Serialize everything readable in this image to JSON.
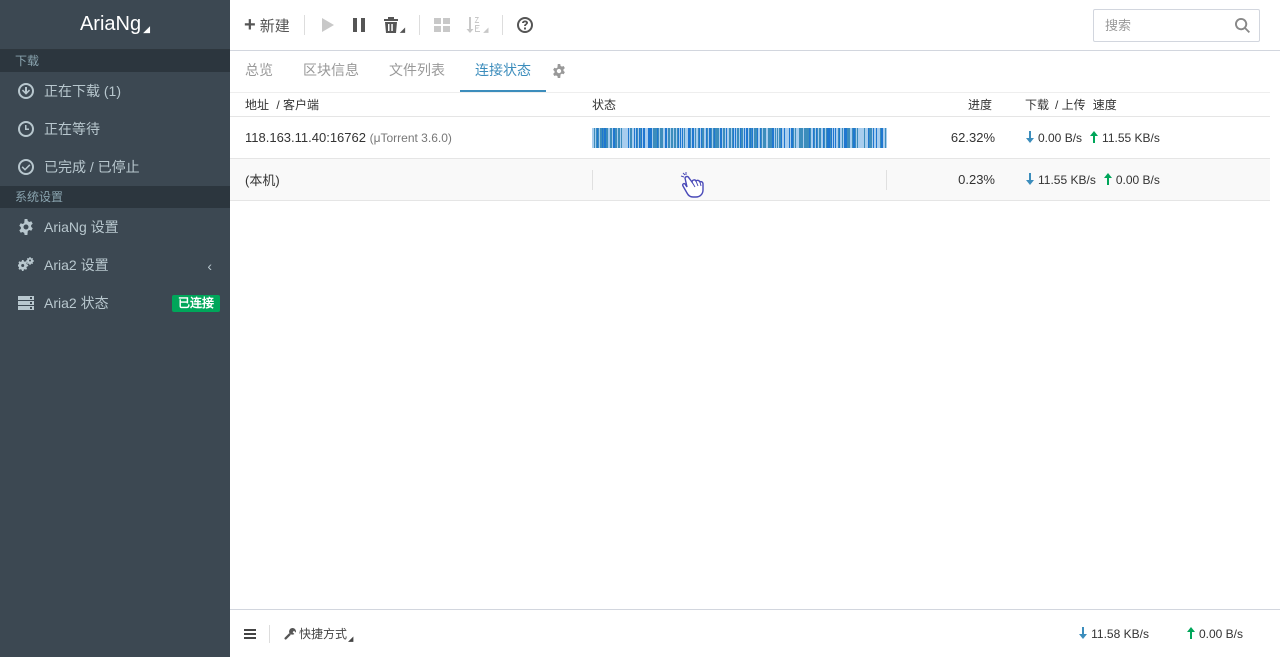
{
  "app": {
    "brand": "AriaNg"
  },
  "sidebar": {
    "download_header": "下载",
    "download_items": [
      {
        "label": "正在下载 (1)",
        "icon": "download-circle-icon"
      },
      {
        "label": "正在等待",
        "icon": "clock-icon"
      },
      {
        "label": "已完成 / 已停止",
        "icon": "check-circle-icon"
      }
    ],
    "settings_header": "系统设置",
    "settings_items": [
      {
        "label": "AriaNg 设置",
        "icon": "gear-icon"
      },
      {
        "label": "Aria2 设置",
        "icon": "gears-icon"
      },
      {
        "label": "Aria2 状态",
        "icon": "server-icon",
        "badge": "已连接"
      }
    ]
  },
  "toolbar": {
    "new_label": "新建",
    "search_placeholder": "搜索"
  },
  "tabs": [
    {
      "label": "总览",
      "active": false
    },
    {
      "label": "区块信息",
      "active": false
    },
    {
      "label": "文件列表",
      "active": false
    },
    {
      "label": "连接状态",
      "active": true
    }
  ],
  "table": {
    "headers": {
      "address": "地址",
      "client": "/ 客户端",
      "status": "状态",
      "progress": "进度",
      "download": "下载",
      "upload": "/ 上传",
      "speed": "速度"
    },
    "rows": [
      {
        "address": "118.163.11.40:16762",
        "client": "(μTorrent 3.6.0)",
        "progress": "62.32%",
        "down_speed": "0.00 B/s",
        "up_speed": "11.55 KB/s"
      },
      {
        "address": "(本机)",
        "client": "",
        "progress": "0.23%",
        "down_speed": "11.55 KB/s",
        "up_speed": "0.00 B/s"
      }
    ]
  },
  "footer": {
    "shortcut_label": "快捷方式",
    "total_down": "11.58 KB/s",
    "total_up": "0.00 B/s"
  },
  "colors": {
    "sidebar_bg": "#3c4852",
    "accent": "#3c8dbc",
    "connected_badge": "#00a65a"
  }
}
